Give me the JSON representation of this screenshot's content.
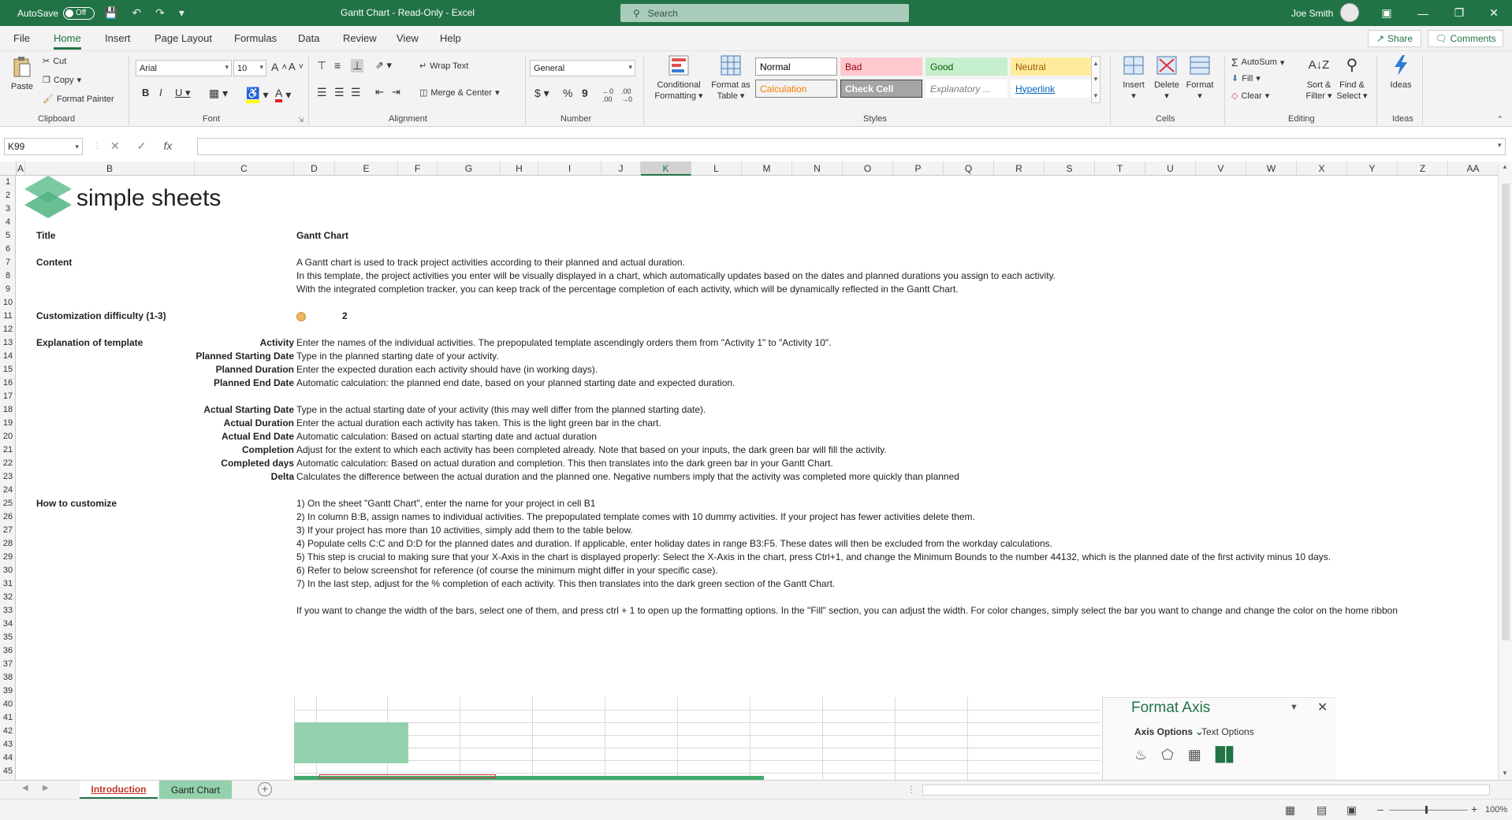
{
  "titlebar": {
    "autosave_label": "AutoSave",
    "autosave_state": "Off",
    "title": "Gantt Chart  -  Read-Only  -  Excel",
    "search_placeholder": "Search",
    "user": "Joe Smith"
  },
  "menu": {
    "tabs": [
      "File",
      "Home",
      "Insert",
      "Page Layout",
      "Formulas",
      "Data",
      "Review",
      "View",
      "Help"
    ],
    "active": "Home",
    "share": "Share",
    "comments": "Comments"
  },
  "ribbon": {
    "clipboard": {
      "label": "Clipboard",
      "paste": "Paste",
      "cut": "Cut",
      "copy": "Copy",
      "format_painter": "Format Painter"
    },
    "font": {
      "label": "Font",
      "name": "Arial",
      "size": "10"
    },
    "alignment": {
      "label": "Alignment",
      "wrap_text": "Wrap Text",
      "merge_center": "Merge & Center"
    },
    "number": {
      "label": "Number",
      "format": "General"
    },
    "styles": {
      "label": "Styles",
      "conditional_formatting": [
        "Conditional",
        "Formatting"
      ],
      "format_as_table": [
        "Format as",
        "Table"
      ],
      "cells": [
        {
          "name": "Normal",
          "bg": "#ffffff",
          "fg": "#000000",
          "border": "#9c9c9c"
        },
        {
          "name": "Bad",
          "bg": "#ffc7ce",
          "fg": "#9c0006",
          "border": "#ffc7ce"
        },
        {
          "name": "Good",
          "bg": "#c6efce",
          "fg": "#006100",
          "border": "#c6efce"
        },
        {
          "name": "Neutral",
          "bg": "#ffeb9c",
          "fg": "#9c5700",
          "border": "#ffeb9c"
        },
        {
          "name": "Calculation",
          "bg": "#f2f2f2",
          "fg": "#fa7d00",
          "border": "#7f7f7f"
        },
        {
          "name": "Check Cell",
          "bg": "#a5a5a5",
          "fg": "#ffffff",
          "border": "#3f3f3f"
        },
        {
          "name": "Explanatory ...",
          "bg": "#ffffff",
          "fg": "#7f7f7f",
          "border": "#ffffff"
        },
        {
          "name": "Hyperlink",
          "bg": "#ffffff",
          "fg": "#0563c1",
          "border": "#ffffff"
        }
      ]
    },
    "cells": {
      "label": "Cells",
      "insert": "Insert",
      "delete": "Delete",
      "format": "Format"
    },
    "editing": {
      "label": "Editing",
      "autosum": "AutoSum",
      "fill": "Fill",
      "clear": "Clear",
      "sort_filter": [
        "Sort &",
        "Filter"
      ],
      "find_select": [
        "Find &",
        "Select"
      ]
    },
    "ideas": {
      "label": "Ideas",
      "button": "Ideas"
    }
  },
  "formula_bar": {
    "name_box": "K99",
    "formula": ""
  },
  "columns": [
    {
      "name": "A",
      "w": 11
    },
    {
      "name": "B",
      "w": 215
    },
    {
      "name": "C",
      "w": 126
    },
    {
      "name": "D",
      "w": 52
    },
    {
      "name": "E",
      "w": 80
    },
    {
      "name": "F",
      "w": 50
    },
    {
      "name": "G",
      "w": 80
    },
    {
      "name": "H",
      "w": 48
    },
    {
      "name": "I",
      "w": 80
    },
    {
      "name": "J",
      "w": 50
    },
    {
      "name": "K",
      "w": 64
    },
    {
      "name": "L",
      "w": 64
    },
    {
      "name": "M",
      "w": 64
    },
    {
      "name": "N",
      "w": 64
    },
    {
      "name": "O",
      "w": 64
    },
    {
      "name": "P",
      "w": 64
    },
    {
      "name": "Q",
      "w": 64
    },
    {
      "name": "R",
      "w": 64
    },
    {
      "name": "S",
      "w": 64
    },
    {
      "name": "T",
      "w": 64
    },
    {
      "name": "U",
      "w": 64
    },
    {
      "name": "V",
      "w": 64
    },
    {
      "name": "W",
      "w": 64
    },
    {
      "name": "X",
      "w": 64
    },
    {
      "name": "Y",
      "w": 64
    },
    {
      "name": "Z",
      "w": 64
    },
    {
      "name": "AA",
      "w": 64
    }
  ],
  "selected_column": "K",
  "logo_text": "simple sheets",
  "sheet": {
    "title_label": "Title",
    "title_value": "Gantt Chart",
    "content_label": "Content",
    "content_lines": [
      "A Gantt chart is used to track project activities according to their planned and actual duration.",
      "In this template, the project activities you enter will be visually displayed in a chart, which automatically updates based on the dates and planned durations you assign to each activity.",
      "With the integrated completion tracker, you can keep track of the percentage completion of each activity, which will be dynamically reflected in the Gantt Chart."
    ],
    "difficulty_label": "Customization difficulty (1-3)",
    "difficulty_value": "2",
    "explanation_label": "Explanation of template",
    "explanations": [
      {
        "term": "Activity",
        "text": "Enter the names of the individual activities. The prepopulated template ascendingly orders them from \"Activity 1\" to \"Activity 10\"."
      },
      {
        "term": "Planned Starting Date",
        "text": "Type in the planned starting date of your activity."
      },
      {
        "term": "Planned Duration",
        "text": "Enter the expected duration each activity should have (in working days)."
      },
      {
        "term": "Planned End Date",
        "text": "Automatic calculation: the planned end date, based on your planned starting date and expected duration."
      },
      {
        "term": "Actual Starting Date",
        "text": "Type in the actual starting date of your activity (this may well differ from the planned starting date)."
      },
      {
        "term": "Actual Duration",
        "text": "Enter the actual duration each activity has taken. This is the light green bar in the chart."
      },
      {
        "term": "Actual End Date",
        "text": "Automatic calculation: Based on actual starting date and actual duration"
      },
      {
        "term": "Completion",
        "text": "Adjust for the extent to which each activity has been completed already. Note that based on your inputs, the dark green bar will fill the activity."
      },
      {
        "term": "Completed days",
        "text": "Automatic calculation: Based on actual duration and completion. This then translates into the dark green bar in your Gantt Chart."
      },
      {
        "term": "Delta",
        "text": "Calculates the difference between the actual duration and the planned one. Negative numbers imply that the activity was completed more quickly than planned"
      }
    ],
    "howto_label": "How to customize",
    "howto_steps": [
      "1) On the sheet \"Gantt Chart\", enter the name for your project in cell B1",
      "2) In column B:B, assign names to individual activities. The prepopulated template comes with 10 dummy activities. If your project has fewer activities delete them.",
      "3) If your project has more than 10 activities, simply add them to the table below.",
      "4) Populate cells C:C and D:D for the planned dates and duration. If applicable, enter holiday dates in range B3:F5. These dates will then be excluded from the workday calculations.",
      "5) This step is crucial to making sure that your X-Axis in the chart is displayed properly: Select the X-Axis in the chart, press Ctrl+1, and change the Minimum Bounds to the number 44132, which is the planned date of the first activity minus 10 days.",
      "6) Refer to below screenshot for reference (of course the minimum might differ in your specific case).",
      "7) In the last step, adjust for the % completion of each activity. This then translates into the dark green section of the Gantt Chart."
    ],
    "bars_note": "If you want to change the width of the bars, select one of them, and press ctrl + 1 to open up the formatting options. In the \"Fill\" section, you can adjust the width. For color changes, simply select the bar you want to change and change the color on the home ribbon"
  },
  "format_axis": {
    "title": "Format Axis",
    "tab_axis": "Axis Options",
    "tab_text": "Text Options"
  },
  "sheet_tabs": [
    {
      "name": "Introduction",
      "active": true
    },
    {
      "name": "Gantt Chart",
      "active": false
    }
  ],
  "status": {
    "zoom": "100%"
  },
  "colors": {
    "accent": "#217346",
    "difficulty_dot": "#f0b860",
    "bar_light": "#93d1ac",
    "bar_dark": "#3faa6c"
  }
}
